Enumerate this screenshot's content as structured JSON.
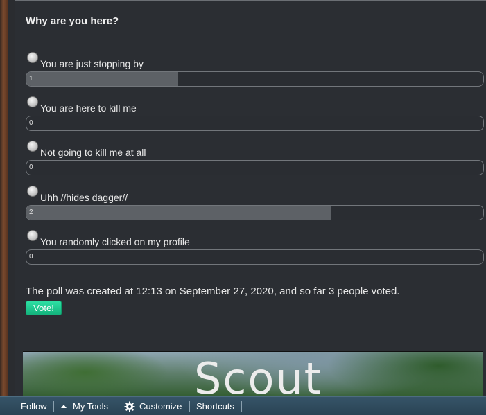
{
  "poll": {
    "title": "Why are you here?",
    "options": [
      {
        "label": "You are just stopping by",
        "votes": "1",
        "fraction": 0.333
      },
      {
        "label": "You are here to kill me",
        "votes": "0",
        "fraction": 0
      },
      {
        "label": "Not going to kill me at all",
        "votes": "0",
        "fraction": 0
      },
      {
        "label": "Uhh //hides dagger//",
        "votes": "2",
        "fraction": 0.667
      },
      {
        "label": "You randomly clicked on my profile",
        "votes": "0",
        "fraction": 0
      }
    ],
    "summary": "The poll was created at 12:13 on September 27, 2020, and so far 3 people voted.",
    "vote_label": "Vote!"
  },
  "banner": {
    "title": "Scout"
  },
  "toolbar": {
    "follow": "Follow",
    "my_tools": "My Tools",
    "customize": "Customize",
    "shortcuts": "Shortcuts",
    "icons": [
      "caret-up-icon",
      "gear-icon"
    ]
  },
  "colors": {
    "vote_button": "#14b37d",
    "toolbar_bg": "#2f4b5e",
    "bar_fill": "#5d6166",
    "panel_bg": "#2b2e33"
  }
}
